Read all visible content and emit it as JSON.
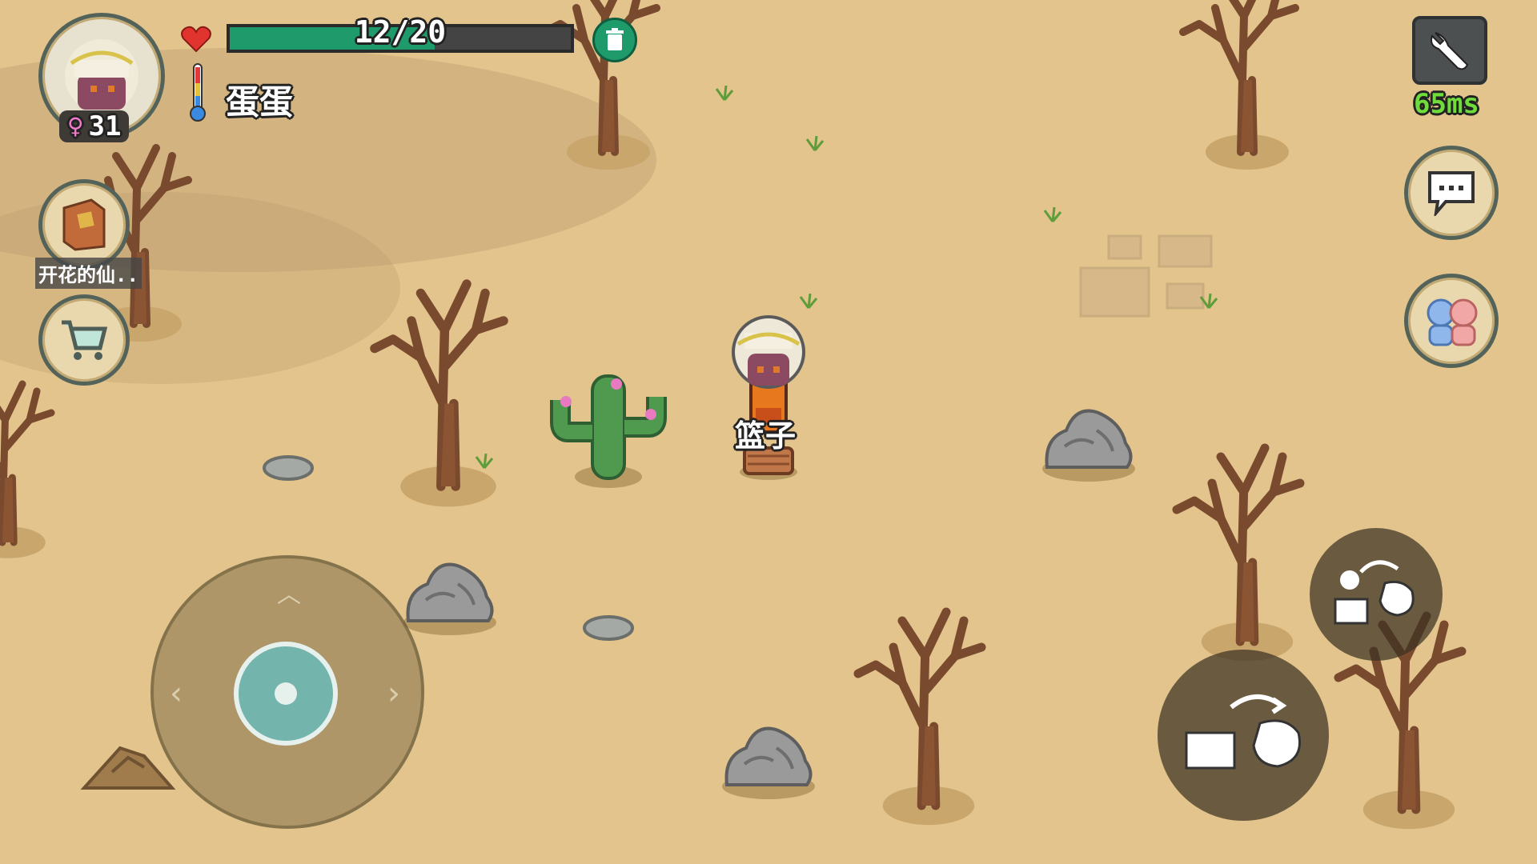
{
  "player": {
    "name": "蛋蛋",
    "gender_symbol": "♀",
    "age": "31",
    "health_text": "12/20",
    "health_fraction": 0.6
  },
  "held_item": {
    "label": "篮子"
  },
  "quest": {
    "label": "开花的仙.."
  },
  "network": {
    "ping": "65ms"
  },
  "controls": {
    "joystick": {
      "directions": [
        "up",
        "down",
        "left",
        "right"
      ]
    },
    "action_buttons": [
      "drop-item",
      "throw-item"
    ]
  },
  "icons": {
    "settings": "wrench-icon",
    "chat": "speech-bubble-icon",
    "social": "friends-icon",
    "shop": "shopping-cart-icon",
    "health": "heart-icon",
    "temperature": "thermometer-icon",
    "trash": "trash-icon"
  },
  "colors": {
    "sand": "#e2c48c",
    "health_fill": "#1f9a6b",
    "ping": "#6fdc3c"
  }
}
